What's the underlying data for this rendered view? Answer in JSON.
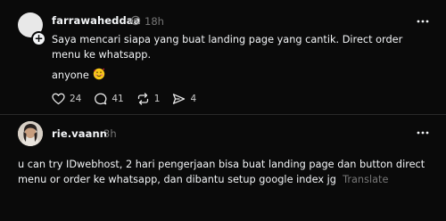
{
  "post": {
    "username": "farrawaheddaa",
    "timestamp": "18h",
    "text_line1": "Saya mencari siapa yang buat landing page yang cantik. Direct order menu ke whatsapp.",
    "text_line2": "anyone",
    "emoji": "smiling-face-with-hearts",
    "actions": {
      "likes": "24",
      "comments": "41",
      "reposts": "1",
      "shares": "4"
    }
  },
  "reply": {
    "username": "rie.vaann",
    "timestamp": "3h",
    "text": "u can try IDwebhost, 2 hari pengerjaan bisa buat landing page dan button direct menu or order ke whatsapp, dan dibantu setup google index jg",
    "translate_label": "Translate"
  },
  "colors": {
    "background": "#0a0a0a",
    "text": "#f3f5f7",
    "muted": "#777777"
  },
  "icons": [
    "plus-icon",
    "threads-icon",
    "more-icon",
    "heart-icon",
    "comment-icon",
    "repost-icon",
    "share-icon"
  ]
}
